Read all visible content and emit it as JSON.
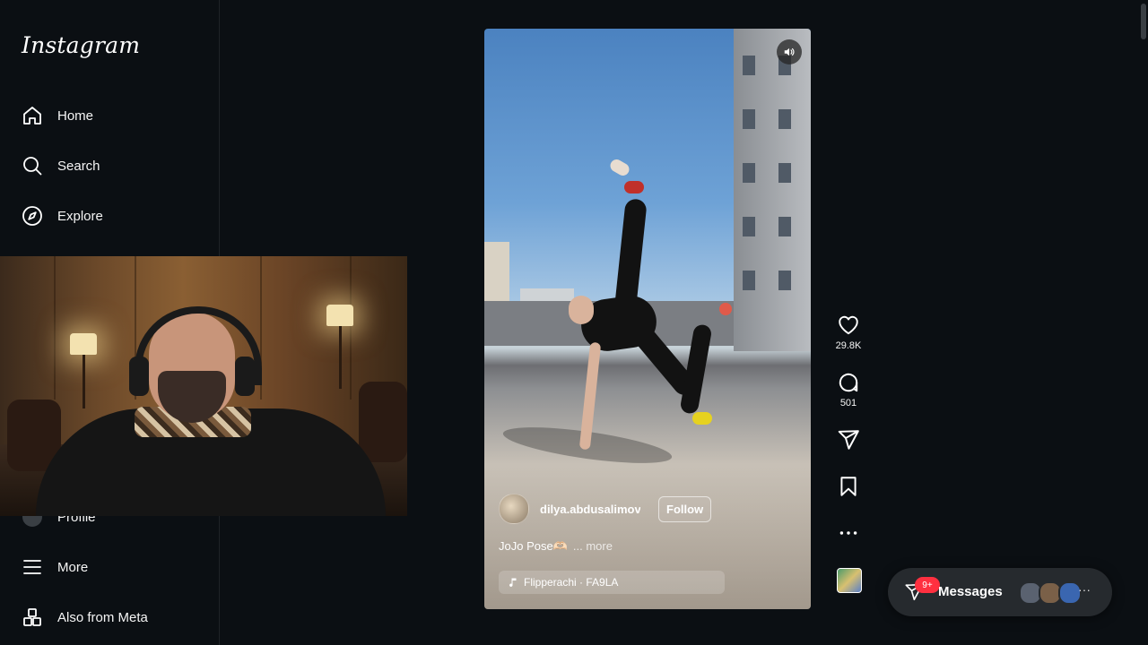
{
  "sidebar": {
    "logo": "Instagram",
    "items": [
      {
        "label": "Home",
        "icon": "home-icon"
      },
      {
        "label": "Search",
        "icon": "search-icon"
      },
      {
        "label": "Explore",
        "icon": "compass-icon"
      },
      {
        "label": "Profile",
        "icon": "profile-icon"
      },
      {
        "label": "More",
        "icon": "menu-icon"
      },
      {
        "label": "Also from Meta",
        "icon": "grid-icon"
      }
    ]
  },
  "reel": {
    "author": "dilya.abdusalimov",
    "follow_label": "Follow",
    "caption": "JoJo Pose🫶🏻",
    "more_label": "... more",
    "audio": "Flipperachi · FA9LA",
    "mute_icon": "speaker-icon"
  },
  "actions": {
    "likes": "29.8K",
    "comments": "501"
  },
  "messages": {
    "label": "Messages",
    "badge": "9+",
    "more": "···"
  },
  "colors": {
    "background": "#0b0f13",
    "badge": "#ff3040",
    "messages_bar": "#262a2e"
  }
}
